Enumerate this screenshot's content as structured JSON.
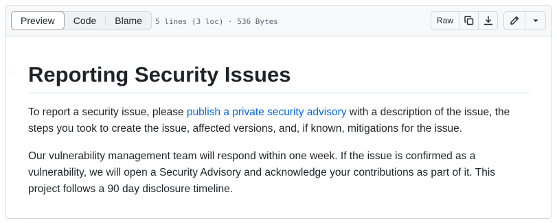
{
  "toolbar": {
    "tabs": [
      {
        "label": "Preview",
        "active": true
      },
      {
        "label": "Code",
        "active": false
      },
      {
        "label": "Blame",
        "active": false
      }
    ],
    "file_info": "5 lines (3 loc) · 536 Bytes",
    "actions": {
      "raw_label": "Raw",
      "copy_icon": "copy-icon",
      "download_icon": "download-icon",
      "edit_icon": "pencil-icon",
      "more_icon": "triangle-down-icon"
    }
  },
  "document": {
    "title": "Reporting Security Issues",
    "para1": {
      "before_link": "To report a security issue, please ",
      "link_text": "publish a private security advisory",
      "after_link": " with a description of the issue, the steps you took to create the issue, affected versions, and, if known, mitigations for the issue."
    },
    "para2": "Our vulnerability management team will respond within one week. If the issue is confirmed as a vulnerability, we will open a Security Advisory and acknowledge your contributions as part of it. This project follows a 90 day disclosure timeline."
  },
  "colors": {
    "link": "#0969da",
    "border": "#d1d9e0",
    "toolbar_bg": "#f6f8fa"
  }
}
